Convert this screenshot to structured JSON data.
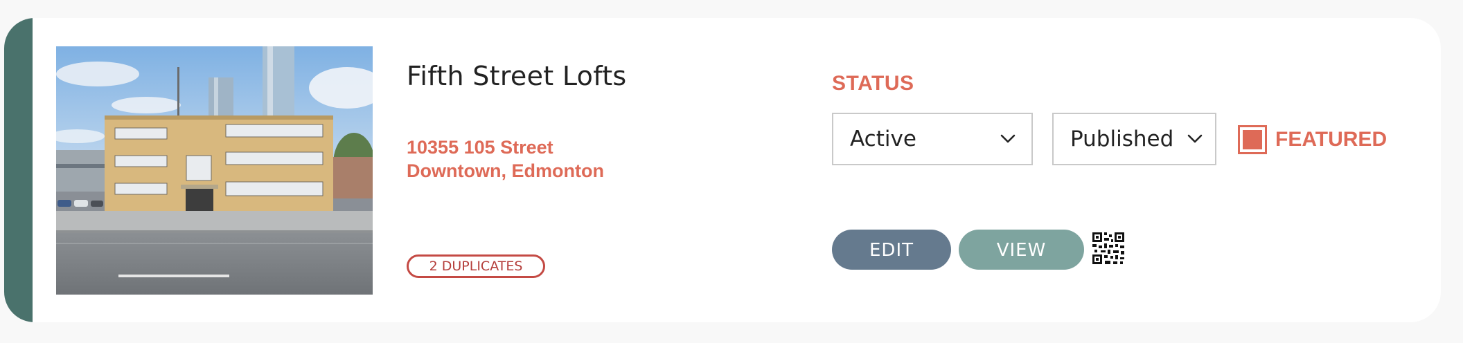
{
  "listing": {
    "name": "Fifth Street Lofts",
    "address_line1": "10355 105 Street",
    "address_line2": "Downtown, Edmonton",
    "duplicates_label": "2 DUPLICATES"
  },
  "status": {
    "heading": "STATUS",
    "state_value": "Active",
    "publish_value": "Published",
    "featured_label": "FEATURED",
    "featured_checked": true
  },
  "actions": {
    "edit_label": "EDIT",
    "view_label": "VIEW"
  },
  "colors": {
    "accent_bar": "#4a726c",
    "brand_coral": "#de6a57",
    "edit_button": "#657a8e",
    "view_button": "#7ea49f",
    "duplicates_border": "#c44a44"
  },
  "icons": {
    "select_chevron": "chevron-down-icon",
    "qr": "qr-code-icon"
  }
}
